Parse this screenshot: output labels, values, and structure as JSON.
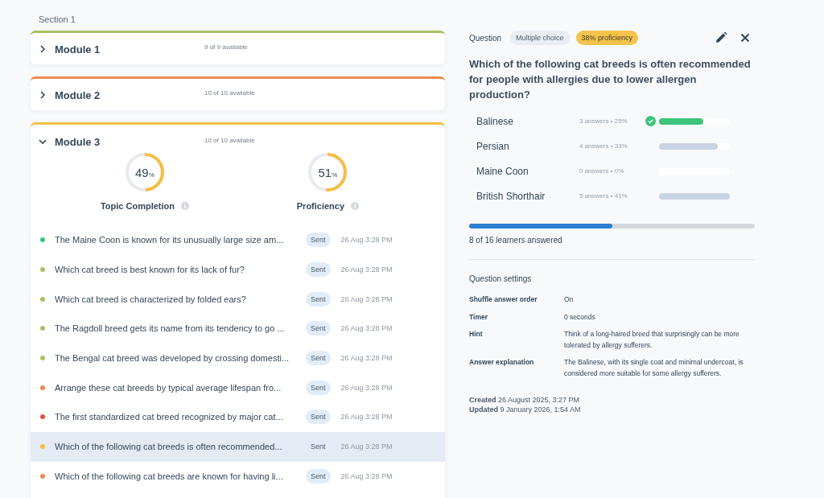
{
  "section": {
    "title": "Section 1"
  },
  "modules": [
    {
      "title": "Module 1",
      "availability": "9 of 9 available",
      "color": "#a5c363",
      "expanded": false
    },
    {
      "title": "Module 2",
      "availability": "10 of 10 available",
      "color": "#ee8c4f",
      "expanded": false
    },
    {
      "title": "Module 3",
      "availability": "10 of 10 available",
      "color": "#f4bf45",
      "expanded": true,
      "stats": [
        {
          "value": "49",
          "unit": "%",
          "label": "Topic Completion",
          "level": 0.49
        },
        {
          "value": "51",
          "unit": "%",
          "label": "Proficiency",
          "level": 0.51
        }
      ],
      "questions": [
        {
          "text": "The Maine Coon is known for its unusually large size am...",
          "status": "Sent",
          "time": "26 Aug 3:28 PM",
          "color": "#3dc47e",
          "selected": false
        },
        {
          "text": "Which cat breed is best known for its lack of fur?",
          "status": "Sent",
          "time": "26 Aug 3:28 PM",
          "color": "#a5c363",
          "selected": false
        },
        {
          "text": "Which cat breed is characterized by folded ears?",
          "status": "Sent",
          "time": "26 Aug 3:28 PM",
          "color": "#a5c363",
          "selected": false
        },
        {
          "text": "The Ragdoll breed gets its name from its tendency to go ...",
          "status": "Sent",
          "time": "26 Aug 3:28 PM",
          "color": "#a5c363",
          "selected": false
        },
        {
          "text": "The Bengal cat breed was developed by crossing domesti...",
          "status": "Sent",
          "time": "26 Aug 3:28 PM",
          "color": "#a5c363",
          "selected": false
        },
        {
          "text": "Arrange these cat breeds by typical average lifespan fro...",
          "status": "Sent",
          "time": "26 Aug 3:28 PM",
          "color": "#ee8c4f",
          "selected": false
        },
        {
          "text": "The first standardized cat breed recognized by major cat...",
          "status": "Sent",
          "time": "26 Aug 3:28 PM",
          "color": "#e8513f",
          "selected": false
        },
        {
          "text": "Which of the following cat breeds is often recommended...",
          "status": "Sent",
          "time": "26 Aug 3:28 PM",
          "color": "#f4bf45",
          "selected": true
        },
        {
          "text": "Which of the following cat breeds are known for having li...",
          "status": "Sent",
          "time": "26 Aug 3:28 PM",
          "color": "#ee8c4f",
          "selected": false
        }
      ]
    }
  ],
  "detail": {
    "label": "Question",
    "type_badge": "Multiple choice",
    "proficiency_badge": "38% proficiency",
    "question": "Which of the following cat breeds is often recommended for people with allergies due to lower allergen production?",
    "answers": [
      {
        "name": "Balinese",
        "stats": "3 answers • 25%",
        "correct": true,
        "level": 0.62
      },
      {
        "name": "Persian",
        "stats": "4 answers • 33%",
        "correct": false,
        "level": 0.83
      },
      {
        "name": "Maine Coon",
        "stats": "0 answers • 0%",
        "correct": false,
        "level": 0
      },
      {
        "name": "British Shorthair",
        "stats": "5 answers • 41%",
        "correct": false,
        "level": 1
      }
    ],
    "progress": {
      "level": 0.5,
      "caption": "8 of 16 learners answered"
    },
    "settings_title": "Question settings",
    "settings": [
      {
        "label": "Shuffle answer order",
        "value": "On"
      },
      {
        "label": "Timer",
        "value": "0 seconds"
      },
      {
        "label": "Hint",
        "value": "Think of a long-haired breed that surprisingly can be more tolerated by allergy sufferers."
      },
      {
        "label": "Answer explanation",
        "value": "The Balinese, with its single coat and minimal undercoat, is considered more suitable for some allergy sufferers."
      }
    ],
    "created": "**Created** 26 August 2025, 3:27 PM",
    "updated": "**Updated** 9 January 2026, 1:54 AM"
  }
}
